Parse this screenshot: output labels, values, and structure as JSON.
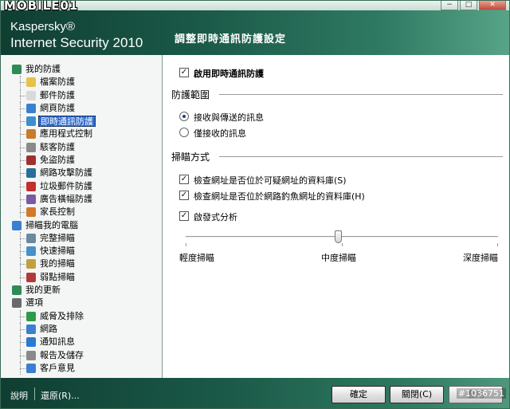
{
  "window": {
    "logo_text": "MOBILE01"
  },
  "header": {
    "brand_line1": "Kaspersky®",
    "brand_line2": "Internet Security 2010",
    "page_title": "調整即時通訊防護設定"
  },
  "sidebar": {
    "items": [
      {
        "label": "我的防護",
        "level": 0,
        "icon": "shield-icon",
        "color": "#2e8b57"
      },
      {
        "label": "檔案防護",
        "level": 1,
        "icon": "folder-icon",
        "color": "#e8c04a"
      },
      {
        "label": "郵件防護",
        "level": 1,
        "icon": "envelope-icon",
        "color": "#d9d9d9"
      },
      {
        "label": "網頁防護",
        "level": 1,
        "icon": "globe-icon",
        "color": "#3b7fd0"
      },
      {
        "label": "即時通訊防護",
        "level": 1,
        "icon": "chat-icon",
        "color": "#3b8ed0",
        "selected": true
      },
      {
        "label": "應用程式控制",
        "level": 1,
        "icon": "apps-icon",
        "color": "#c97a2a"
      },
      {
        "label": "駭客防護",
        "level": 1,
        "icon": "filter-icon",
        "color": "#8a8a8a"
      },
      {
        "label": "免盜防護",
        "level": 1,
        "icon": "lock-icon",
        "color": "#a03030"
      },
      {
        "label": "網路攻擊防護",
        "level": 1,
        "icon": "network-icon",
        "color": "#2a6e9a"
      },
      {
        "label": "垃圾郵件防護",
        "level": 1,
        "icon": "spam-icon",
        "color": "#c03030"
      },
      {
        "label": "廣告橫幅防護",
        "level": 1,
        "icon": "banner-icon",
        "color": "#7a5aa0"
      },
      {
        "label": "家長控制",
        "level": 1,
        "icon": "parental-icon",
        "color": "#d07a2a"
      },
      {
        "label": "掃瞄我的電腦",
        "level": 0,
        "icon": "magnifier-icon",
        "color": "#3b7fd0"
      },
      {
        "label": "完整掃瞄",
        "level": 1,
        "icon": "scan-full-icon",
        "color": "#6a8aa0"
      },
      {
        "label": "快速掃瞄",
        "level": 1,
        "icon": "scan-quick-icon",
        "color": "#4a90c8"
      },
      {
        "label": "我的掃瞄",
        "level": 1,
        "icon": "scan-custom-icon",
        "color": "#c0a040"
      },
      {
        "label": "弱點掃瞄",
        "level": 1,
        "icon": "scan-vuln-icon",
        "color": "#b03a3a"
      },
      {
        "label": "我的更新",
        "level": 0,
        "icon": "update-icon",
        "color": "#2e8b57"
      },
      {
        "label": "選項",
        "level": 0,
        "icon": "gear-icon",
        "color": "#6a6a6a"
      },
      {
        "label": "威脅及排除",
        "level": 1,
        "icon": "check-icon",
        "color": "#2e9a4a"
      },
      {
        "label": "網路",
        "level": 1,
        "icon": "globe-network-icon",
        "color": "#3b7fd0"
      },
      {
        "label": "通知訊息",
        "level": 1,
        "icon": "info-icon",
        "color": "#2a7ad0"
      },
      {
        "label": "報告及儲存",
        "level": 1,
        "icon": "report-icon",
        "color": "#8a8a8a"
      },
      {
        "label": "客戶意見",
        "level": 1,
        "icon": "feedback-icon",
        "color": "#3b7fd0"
      }
    ]
  },
  "content": {
    "enable_label": "啟用即時通訊防護",
    "enable_checked": true,
    "scope_title": "防護範圍",
    "scope_options": [
      {
        "label": "接收與傳送的訊息",
        "selected": true
      },
      {
        "label": "僅接收的訊息",
        "selected": false
      }
    ],
    "scan_title": "掃瞄方式",
    "scan_options": [
      {
        "label": "檢查網址是否位於可疑網址的資料庫(S)",
        "checked": true
      },
      {
        "label": "檢查網址是否位於網路釣魚網址的資料庫(H)",
        "checked": true
      },
      {
        "label": "啟發式分析",
        "checked": true
      }
    ],
    "slider_levels": [
      "輕度掃瞄",
      "中度掃瞄",
      "深度掃瞄"
    ],
    "slider_value": "中度掃瞄"
  },
  "footer": {
    "help_label": "說明",
    "restore_label": "還原(R)...",
    "ok_label": "確定",
    "close_label": "關閉(C)",
    "apply_label": "套用",
    "watermark": "#1036751"
  }
}
